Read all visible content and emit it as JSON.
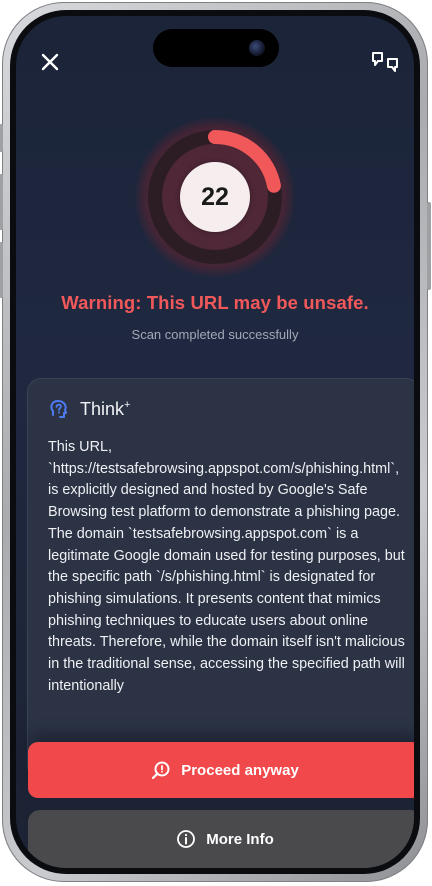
{
  "header": {
    "close_icon": "close-icon",
    "feedback_icon": "thumbs-feedback-icon"
  },
  "score": {
    "value": "22",
    "fraction": 0.22,
    "color": "#f0585a"
  },
  "result": {
    "title": "Warning: This URL may be unsafe.",
    "subtitle": "Scan completed successfully"
  },
  "think": {
    "title": "Think",
    "title_sup": "+",
    "icon": "lightbulb-head-icon",
    "body": "This URL, `https://testsafebrowsing.appspot.com/s/phishing.html`, is explicitly designed and hosted by Google's Safe Browsing test platform to demonstrate a phishing page. The domain `testsafebrowsing.appspot.com` is a legitimate Google domain used for testing purposes, but the specific path `/s/phishing.html` is designated for phishing simulations. It presents content that mimics phishing techniques to educate users about online threats. Therefore, while the domain itself isn't malicious in the traditional sense, accessing the specified path will intentionally"
  },
  "actions": {
    "proceed_label": "Proceed anyway",
    "proceed_icon": "search-warning-icon",
    "more_label": "More Info",
    "more_icon": "info-icon"
  },
  "colors": {
    "accent": "#f1484b",
    "background": "#1e273b",
    "card": "#2b3344",
    "secondary_button": "#4a4a4c"
  }
}
